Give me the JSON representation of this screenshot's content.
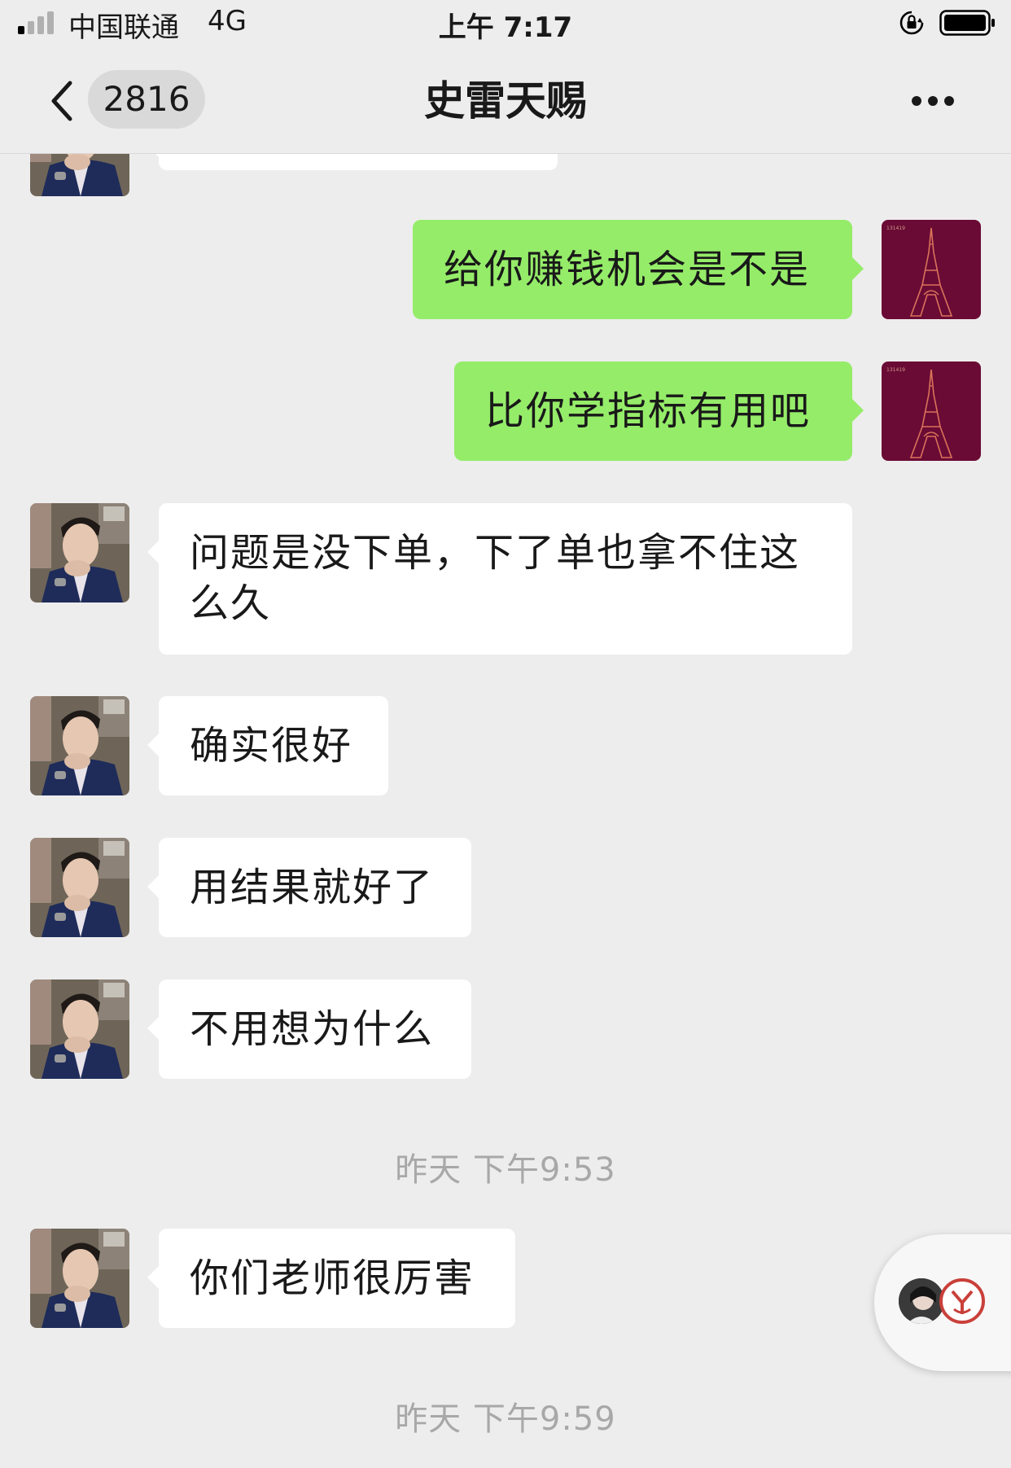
{
  "status_bar": {
    "carrier": "中国联通",
    "network": "4G",
    "time": "上午 7:17",
    "signal_bars": 4,
    "signal_bars_filled": 1
  },
  "nav": {
    "back_icon": "chevron-left-icon",
    "unread_count": "2816",
    "title": "史雷天赐",
    "more_icon": "more-dots-icon"
  },
  "colors": {
    "background": "#ededed",
    "sent_bubble": "#95ec69",
    "received_bubble": "#ffffff",
    "timestamp_text": "#a8a8a8"
  },
  "messages": [
    {
      "side": "left",
      "text": ""
    },
    {
      "side": "right",
      "text": "给你赚钱机会是不是"
    },
    {
      "side": "right",
      "text": "比你学指标有用吧"
    },
    {
      "side": "left",
      "text": "问题是没下单，下了单也拿不住这么久"
    },
    {
      "side": "left",
      "text": "确实很好"
    },
    {
      "side": "left",
      "text": "用结果就好了"
    },
    {
      "side": "left",
      "text": "不用想为什么"
    },
    {
      "side": "left",
      "text": "你们老师很厉害"
    }
  ],
  "timestamps": [
    "昨天 下午9:53",
    "昨天 下午9:59"
  ],
  "floating_widget": {
    "icons": [
      "user-avatar-icon",
      "app-logo-icon"
    ]
  }
}
